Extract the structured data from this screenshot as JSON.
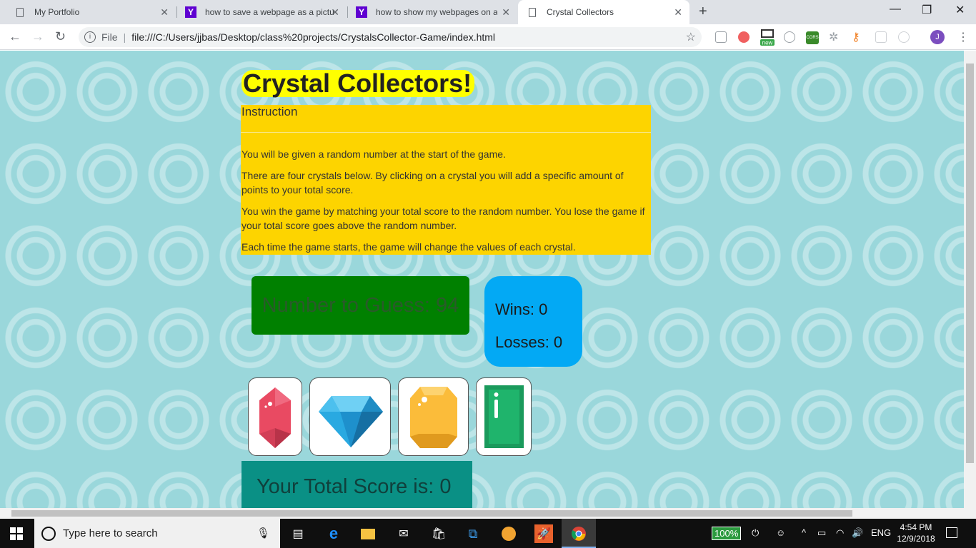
{
  "browser": {
    "tabs": [
      {
        "label": "My Portfolio",
        "favicon": "document-icon"
      },
      {
        "label": "how to save a webpage as a pictu",
        "favicon": "yahoo-icon"
      },
      {
        "label": "how to show my webpages on a",
        "favicon": "yahoo-icon"
      },
      {
        "label": "Crystal Collectors",
        "favicon": "document-icon",
        "active": true
      }
    ],
    "address": {
      "scheme_label": "File",
      "url": "file:///C:/Users/jjbas/Desktop/class%20projects/CrystalsCollector-Game/index.html"
    },
    "profile_initial": "J",
    "extension_badge": "new",
    "cors_badge": "CORS"
  },
  "page": {
    "title": "Crystal Collectors!",
    "instructions": {
      "heading": "Instruction",
      "paragraphs": [
        "You will be given a random number at the start of the game.",
        "There are four crystals below. By clicking on a crystal you will add a specific amount of points to your total score.",
        "You win the game by matching your total score to the random number. You lose the game if your total score goes above the random number.",
        "Each time the game starts, the game will change the values of each crystal."
      ]
    },
    "guess": {
      "text": "Number to Guess: 94",
      "value": 94
    },
    "stats": {
      "wins": "Wins: 0",
      "losses": "Losses: 0"
    },
    "crystals": [
      {
        "name": "red-crystal-icon",
        "color": "#e94a62"
      },
      {
        "name": "blue-diamond-icon",
        "color": "#29a9e1"
      },
      {
        "name": "yellow-gem-icon",
        "color": "#fbbc3a"
      },
      {
        "name": "green-emerald-icon",
        "color": "#1fb46c"
      }
    ],
    "score": {
      "text": "Your Total Score is: 0",
      "value": 0
    },
    "colors": {
      "title_bg": "#ffff00",
      "instructions_bg": "#fdd400",
      "guess_bg": "#008000",
      "stats_bg": "#03a9f4",
      "score_bg": "#0a9085",
      "page_bg": "#9ad7db"
    }
  },
  "taskbar": {
    "search_placeholder": "Type here to search",
    "battery": "100%",
    "language": "ENG",
    "time": "4:54 PM",
    "date": "12/9/2018"
  }
}
